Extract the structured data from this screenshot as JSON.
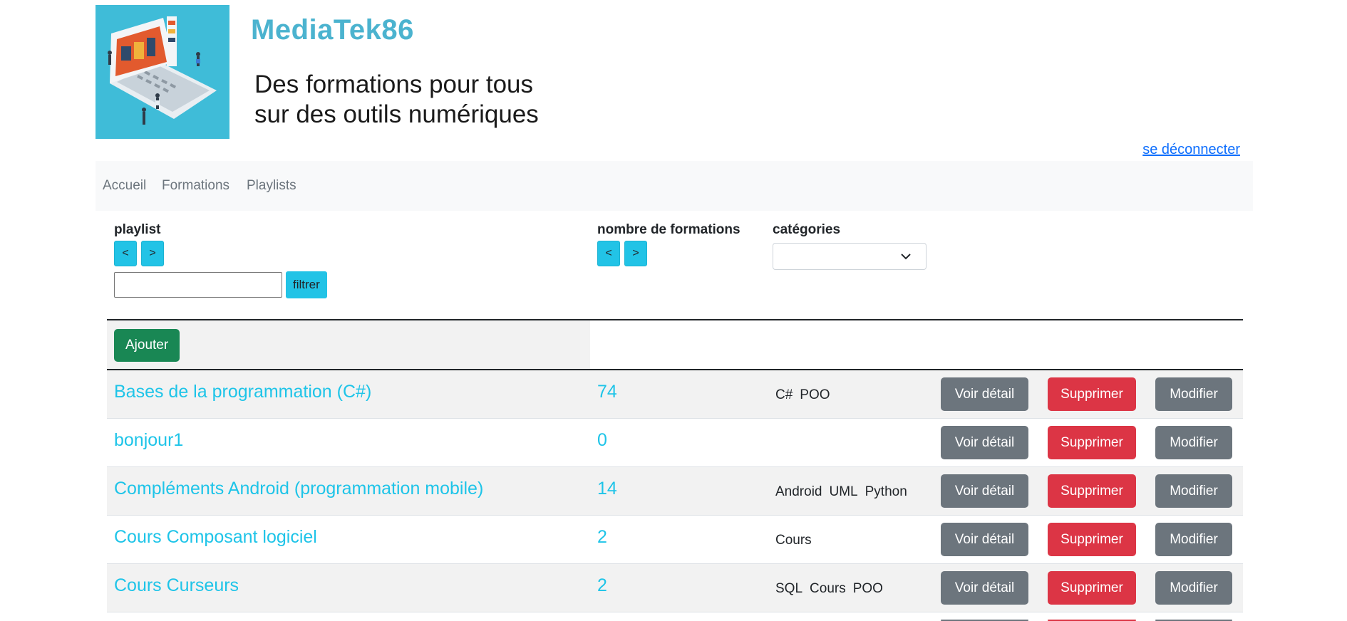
{
  "header": {
    "brand": "MediaTek86",
    "tagline_line1": "Des formations pour tous",
    "tagline_line2": "sur des outils numériques",
    "logout": "se déconnecter"
  },
  "nav": {
    "items": [
      "Accueil",
      "Formations",
      "Playlists"
    ]
  },
  "filters": {
    "playlist_label": "playlist",
    "count_label": "nombre de formations",
    "categories_label": "catégories",
    "sort_asc": "<",
    "sort_desc": ">",
    "filter_button": "filtrer",
    "filter_value": "",
    "categories_selected": ""
  },
  "table": {
    "add_button": "Ajouter",
    "rows": [
      {
        "name": "Bases de la programmation (C#)",
        "count": "74",
        "categories": [
          "C#",
          "POO"
        ]
      },
      {
        "name": "bonjour1",
        "count": "0",
        "categories": []
      },
      {
        "name": "Compléments Android (programmation mobile)",
        "count": "14",
        "categories": [
          "Android",
          "UML",
          "Python"
        ]
      },
      {
        "name": "Cours Composant logiciel",
        "count": "2",
        "categories": [
          "Cours"
        ]
      },
      {
        "name": "Cours Curseurs",
        "count": "2",
        "categories": [
          "SQL",
          "Cours",
          "POO"
        ]
      }
    ],
    "detail_label": "Voir détail",
    "delete_label": "Supprimer",
    "modify_label": "Modifier"
  },
  "colors": {
    "accent": "#1ec4e8",
    "success": "#198754",
    "danger": "#dc3545",
    "secondary": "#6c757d"
  }
}
